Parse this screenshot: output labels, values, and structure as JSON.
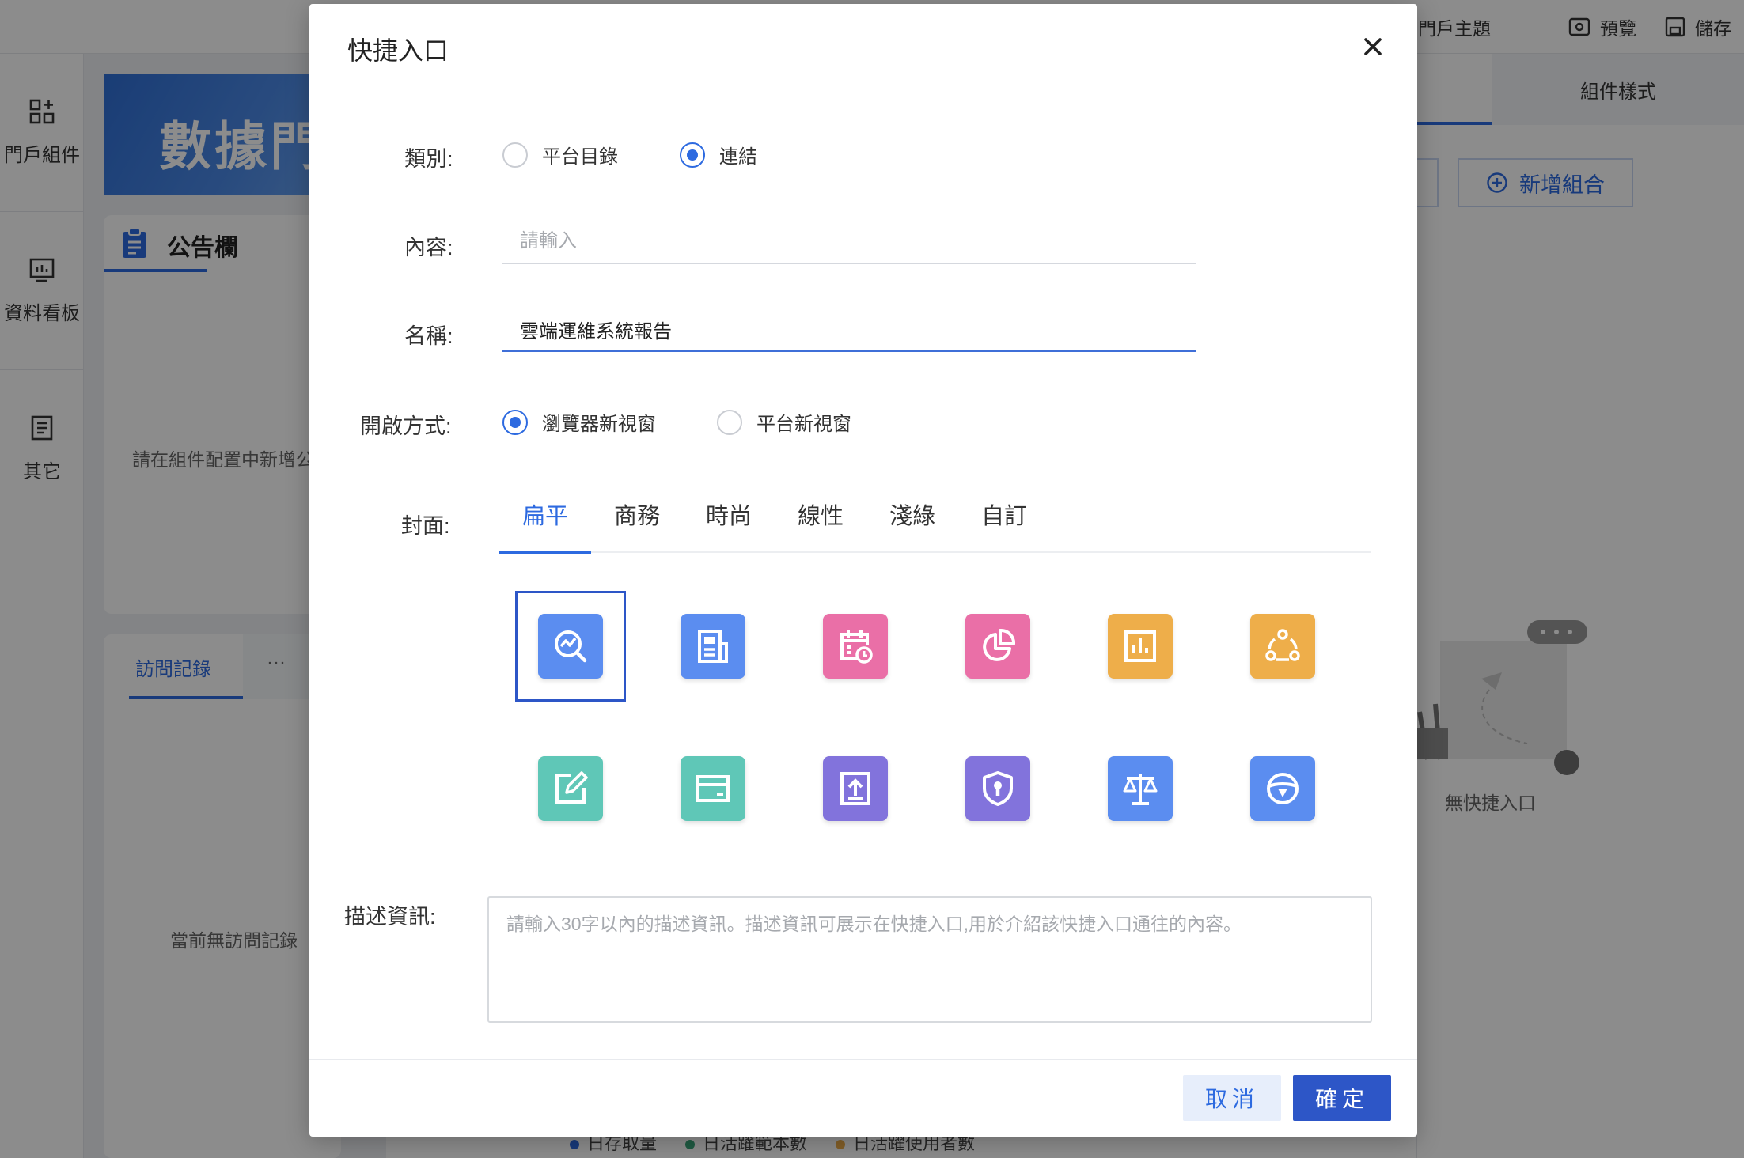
{
  "topbar": {
    "theme_label": "門戶主題",
    "preview_label": "預覽",
    "save_label": "儲存"
  },
  "sidebar": {
    "items": [
      {
        "label": "門戶組件",
        "icon": "widgets-icon"
      },
      {
        "label": "資料看板",
        "icon": "dashboard-icon"
      },
      {
        "label": "其它",
        "icon": "document-icon"
      }
    ]
  },
  "background": {
    "banner_text": "數據門",
    "notice_title": "公告欄",
    "notice_empty": "請在組件配置中新增公",
    "visit_tab": "訪問記錄",
    "visit_more": "···",
    "visit_empty": "當前無訪問記錄",
    "legend": [
      "日存取量",
      "日活躍範本數",
      "日活躍使用者數"
    ]
  },
  "right_panel": {
    "style_tab": "組件樣式",
    "add_group_label": "新增組合",
    "no_entry_label": "無快捷入口"
  },
  "modal": {
    "title": "快捷入口",
    "category_label": "類別:",
    "category_options": [
      "平台目錄",
      "連結"
    ],
    "category_selected": 1,
    "content_label": "內容:",
    "content_placeholder": "請輸入",
    "content_value": "",
    "name_label": "名稱:",
    "name_value": "雲端運維系統報告",
    "open_label": "開啟方式:",
    "open_options": [
      "瀏覽器新視窗",
      "平台新視窗"
    ],
    "open_selected": 0,
    "cover_label": "封面:",
    "cover_tabs": [
      "扁平",
      "商務",
      "時尚",
      "線性",
      "淺綠",
      "自訂"
    ],
    "cover_tab_selected": 0,
    "cover_icons": [
      {
        "icon": "chart-search-icon",
        "color": "#5b8df0"
      },
      {
        "icon": "report-icon",
        "color": "#5b8df0"
      },
      {
        "icon": "calendar-clock-icon",
        "color": "#ea6fa7"
      },
      {
        "icon": "pie-chart-icon",
        "color": "#ea6fa7"
      },
      {
        "icon": "bar-chart-icon",
        "color": "#eeae4a"
      },
      {
        "icon": "network-icon",
        "color": "#eeae4a"
      },
      {
        "icon": "edit-icon",
        "color": "#5fc7b7"
      },
      {
        "icon": "card-icon",
        "color": "#5fc7b7"
      },
      {
        "icon": "upload-icon",
        "color": "#8273dc"
      },
      {
        "icon": "shield-lock-icon",
        "color": "#8273dc"
      },
      {
        "icon": "scale-icon",
        "color": "#5b8df0"
      },
      {
        "icon": "steering-wheel-icon",
        "color": "#5b8df0"
      }
    ],
    "cover_icon_selected": 0,
    "desc_label": "描述資訊:",
    "desc_placeholder": "請輸入30字以內的描述資訊。描述資訊可展示在快捷入口,用於介紹該快捷入口通往的內容。",
    "cancel_label": "取消",
    "ok_label": "確定"
  },
  "colors": {
    "primary": "#2d6ae0",
    "primary_dark": "#2d56c7"
  }
}
